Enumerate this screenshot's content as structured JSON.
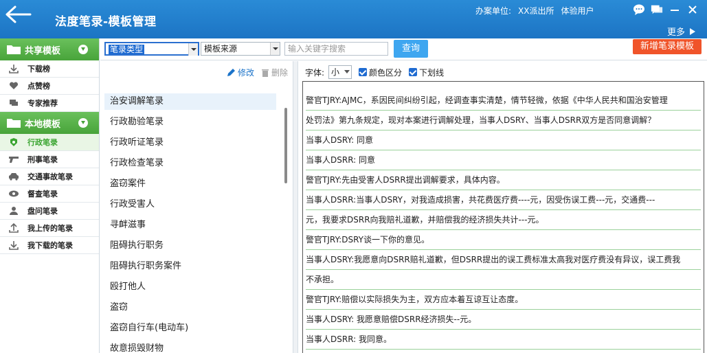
{
  "header": {
    "title": "法度笔录-模板管理",
    "org_label": "办案单位:",
    "org_name": "XX派出所",
    "user": "体验用户",
    "more": "更多"
  },
  "sidebar": {
    "shared_title": "共享模板",
    "shared_items": [
      {
        "label": "下载榜",
        "icon": "download-icon"
      },
      {
        "label": "点赞榜",
        "icon": "heart-icon"
      },
      {
        "label": "专家推荐",
        "icon": "chat-icon"
      }
    ],
    "local_title": "本地模板",
    "local_items": [
      {
        "label": "行政笔录",
        "icon": "badge-icon"
      },
      {
        "label": "刑事笔录",
        "icon": "gun-icon"
      },
      {
        "label": "交通事故笔录",
        "icon": "car-icon"
      },
      {
        "label": "督查笔录",
        "icon": "eye-icon"
      },
      {
        "label": "盘问笔录",
        "icon": "person-icon"
      },
      {
        "label": "我上传的笔录",
        "icon": "upload-icon"
      },
      {
        "label": "我下载的笔录",
        "icon": "download-icon"
      }
    ]
  },
  "toolbar": {
    "type_select": "笔录类型",
    "source_select": "模板来源",
    "search_placeholder": "输入关键字搜索",
    "query_label": "查询",
    "new_label": "新增笔录模板"
  },
  "list": {
    "edit_label": "修改",
    "delete_label": "删除",
    "items": [
      "治安调解笔录",
      "行政勘验笔录",
      "行政听证笔录",
      "行政检查笔录",
      "盗窃案件",
      "行政受害人",
      "寻衅滋事",
      "阻碍执行职务",
      "阻碍执行职务案件",
      "殴打他人",
      "盗窃",
      "盗窃自行车(电动车)",
      "故意损毁财物"
    ]
  },
  "content": {
    "font_label": "字体:",
    "font_size": "小",
    "color_label": "颜色区分",
    "underline_label": "下划线",
    "lines": [
      "警官TJRY:AJMC，系因民间纠纷引起，经调查事实清楚，情节轻微，依据《中华人民共和国治安管理",
      "处罚法》第九条规定，现对本案进行调解处理，当事人DSRY、当事人DSRR双方是否同意调解？",
      "当事人DSRY: 同意",
      "当事人DSRR: 同意",
      "警官TJRY:先由受害人DSRR提出调解要求，具体内容。",
      "当事人DSRR:当事人DSRY，对我造成损害，共花费医疗费----元，因受伤误工费---元，交通费---",
      "元，我要求DSRR向我赔礼道歉，并赔偿我的经济损失共计---元。",
      "警官TJRY:DSRY谈一下你的意见。",
      "当事人DSRY:我愿意向DSRR赔礼道歉，但DSRR提出的误工费标准太高我对医疗费没有异议，误工费我",
      "不承担。",
      "警官TJRY:赔偿以实际损失为主，双方应本着互谅互让态度。",
      "当事人DSRY: 我愿意赔偿DSRR经济损失--元。",
      "当事人DSRR: 我同意。",
      ""
    ]
  },
  "colors": {
    "header_blue": "#1c74c4",
    "green": "#48a43a",
    "orange": "#f0542a",
    "query_blue": "#3ea6f0"
  }
}
